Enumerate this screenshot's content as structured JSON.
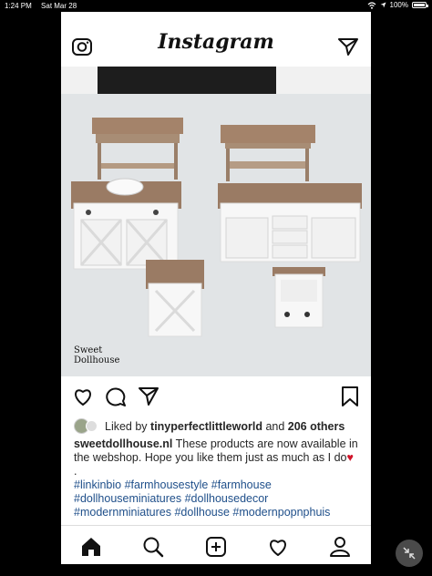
{
  "status_bar": {
    "time": "1:24 PM",
    "date": "Sat Mar 28",
    "battery": "100%"
  },
  "header": {
    "logo": "Instagram",
    "camera_icon": "camera-icon",
    "direct_icon": "paper-plane-icon"
  },
  "photo": {
    "watermark_line1": "Sweet",
    "watermark_line2": "Dollhouse"
  },
  "actions": {
    "like_icon": "heart-icon",
    "comment_icon": "comment-icon",
    "share_icon": "paper-plane-icon",
    "save_icon": "bookmark-icon"
  },
  "likes": {
    "prefix": "Liked by ",
    "user": "tinyperfectlittleworld",
    "middle": " and ",
    "count": "206 others"
  },
  "caption": {
    "username": "sweetdollhouse.nl",
    "text": " These products are now available in the webshop. Hope you like them just as much as I do",
    "emoji": "♥",
    "dot": ".",
    "hashtags_line1": "#linkinbio #farmhousestyle #farmhouse",
    "hashtags_line2": "#dollhouseminiatures #dollhousedecor",
    "hashtags_line3": "#modernminiatures #dollhouse #modernpopnphuis"
  },
  "tabbar": {
    "home": "home-icon",
    "search": "search-icon",
    "add": "add-post-icon",
    "activity": "heart-icon",
    "profile": "profile-icon"
  },
  "colors": {
    "hashtag": "#1f4f8a",
    "heart": "#d0142a"
  }
}
